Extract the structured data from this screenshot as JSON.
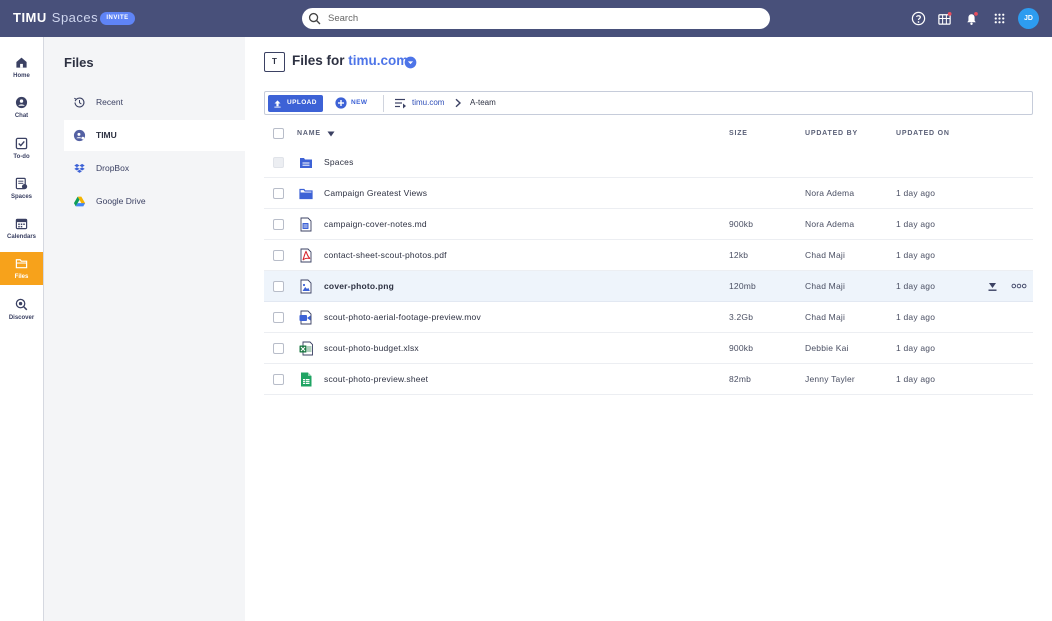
{
  "topbar": {
    "brand_primary": "TIMU",
    "brand_secondary": "Spaces",
    "invite_label": "INVITE",
    "search_placeholder": "Search",
    "icons": [
      "help-icon",
      "apps-store-icon",
      "bell-icon",
      "grid-icon"
    ],
    "avatar_initials": "JD"
  },
  "rail": {
    "items": [
      {
        "label": "Home",
        "icon": "home-icon"
      },
      {
        "label": "Chat",
        "icon": "chat-icon"
      },
      {
        "label": "To-do",
        "icon": "todo-icon"
      },
      {
        "label": "Spaces",
        "icon": "spaces-icon"
      },
      {
        "label": "Calendars",
        "icon": "calendar-icon"
      },
      {
        "label": "Files",
        "icon": "folder-icon",
        "active": true
      },
      {
        "label": "Discover",
        "icon": "discover-icon"
      }
    ]
  },
  "panel": {
    "title": "Files",
    "sources": [
      {
        "label": "Recent",
        "icon": "history-icon"
      },
      {
        "label": "TIMU",
        "icon": "timu-icon",
        "active": true
      },
      {
        "label": "DropBox",
        "icon": "dropbox-icon"
      },
      {
        "label": "Google Drive",
        "icon": "google-drive-icon"
      }
    ]
  },
  "main": {
    "space_badge": "T",
    "title_prefix": "Files for",
    "title_domain": "timu.com",
    "toolbar": {
      "upload_label": "UPLOAD",
      "new_label": "NEW",
      "breadcrumb": [
        "timu.com",
        "A-team"
      ]
    },
    "columns": {
      "name": "NAME",
      "size": "SIZE",
      "updated_by": "UPDATED BY",
      "updated_on": "UPDATED ON"
    },
    "rows": [
      {
        "name": "Spaces",
        "type": "spaces",
        "size": "",
        "by": "",
        "on": ""
      },
      {
        "name": "Campaign Greatest Views",
        "type": "folder",
        "size": "",
        "by": "Nora Adema",
        "on": "1 day ago"
      },
      {
        "name": "campaign-cover-notes.md",
        "type": "doc",
        "size": "900kb",
        "by": "Nora Adema",
        "on": "1 day ago"
      },
      {
        "name": "contact-sheet-scout-photos.pdf",
        "type": "pdf",
        "size": "12kb",
        "by": "Chad Maji",
        "on": "1 day ago"
      },
      {
        "name": "cover-photo.png",
        "type": "image",
        "size": "120mb",
        "by": "Chad Maji",
        "on": "1 day ago",
        "highlight": true
      },
      {
        "name": "scout-photo-aerial-footage-preview.mov",
        "type": "video",
        "size": "3.2Gb",
        "by": "Chad Maji",
        "on": "1 day ago"
      },
      {
        "name": "scout-photo-budget.xlsx",
        "type": "excel",
        "size": "900kb",
        "by": "Debbie Kai",
        "on": "1 day ago"
      },
      {
        "name": "scout-photo-preview.sheet",
        "type": "sheet",
        "size": "82mb",
        "by": "Jenny Tayler",
        "on": "1 day ago"
      }
    ]
  },
  "colors": {
    "topbar": "#48507a",
    "accent": "#3d62d6",
    "active_rail": "#f7a21b",
    "highlight_row": "#eef4fb"
  }
}
